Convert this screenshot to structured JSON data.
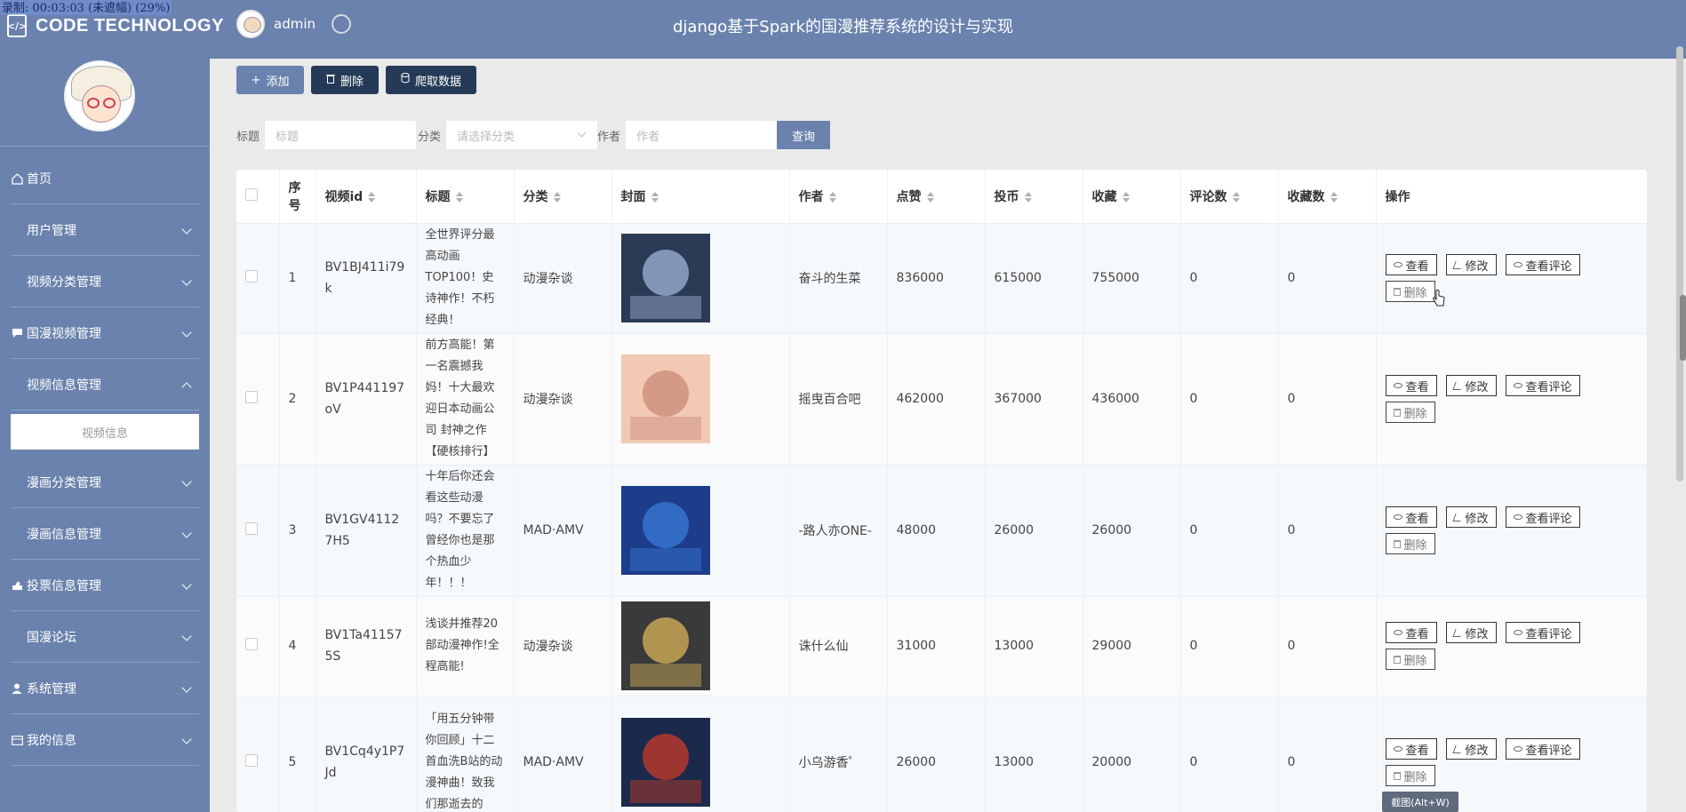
{
  "overlay": {
    "recording": "录制: 00:03:03 (未遮幅) (29%)"
  },
  "header": {
    "brand": "CODE TECHNOLOGY",
    "user": "admin",
    "title": "django基于Spark的国漫推荐系统的设计与实现"
  },
  "sidebar": {
    "items": [
      {
        "label": "首页",
        "icon": "home-icon"
      },
      {
        "label": "用户管理",
        "icon": "grid-icon"
      },
      {
        "label": "视频分类管理",
        "icon": "grid-icon"
      },
      {
        "label": "国漫视频管理",
        "icon": "comment-icon"
      },
      {
        "label": "视频信息管理",
        "icon": "grid-icon",
        "expanded": true
      },
      {
        "label": "漫画分类管理",
        "icon": "grid-icon"
      },
      {
        "label": "漫画信息管理",
        "icon": "grid-icon"
      },
      {
        "label": "投票信息管理",
        "icon": "vote-icon"
      },
      {
        "label": "国漫论坛",
        "icon": "grid-icon"
      },
      {
        "label": "系统管理",
        "icon": "user-icon"
      },
      {
        "label": "我的信息",
        "icon": "card-icon"
      }
    ],
    "subitem": "视频信息"
  },
  "toolbar": {
    "add": "添加",
    "delete": "删除",
    "crawl": "爬取数据"
  },
  "search": {
    "title_label": "标题",
    "title_placeholder": "标题",
    "category_label": "分类",
    "category_placeholder": "请选择分类",
    "author_label": "作者",
    "author_placeholder": "作者",
    "query": "查询"
  },
  "table": {
    "headers": [
      "序号",
      "视频id",
      "标题",
      "分类",
      "封面",
      "作者",
      "点赞",
      "投币",
      "收藏",
      "评论数",
      "收藏数",
      "操作"
    ],
    "actions": {
      "view": "查看",
      "edit": "修改",
      "view_comments": "查看评论",
      "delete": "删除"
    },
    "rows": [
      {
        "no": "1",
        "vid": "BV1BJ411i79k",
        "title": "全世界评分最高动画TOP100！史诗神作！不朽经典！",
        "category": "动漫杂谈",
        "author": "奋斗的生菜",
        "likes": "836000",
        "coins": "615000",
        "favorites": "755000",
        "comments": "0",
        "collects": "0"
      },
      {
        "no": "2",
        "vid": "BV1P441197oV",
        "title": "前方高能！第一名震撼我妈！十大最欢迎日本动画公司 封神之作【硬核排行】",
        "category": "动漫杂谈",
        "author": "摇曳百合吧",
        "likes": "462000",
        "coins": "367000",
        "favorites": "436000",
        "comments": "0",
        "collects": "0"
      },
      {
        "no": "3",
        "vid": "BV1GV41127H5",
        "title": "十年后你还会看这些动漫吗？不要忘了曾经你也是那个热血少年！！！",
        "category": "MAD·AMV",
        "author": "-路人亦ONE-",
        "likes": "48000",
        "coins": "26000",
        "favorites": "26000",
        "comments": "0",
        "collects": "0"
      },
      {
        "no": "4",
        "vid": "BV1Ta411575S",
        "title": "浅谈并推荐20部动漫神作!全程高能!",
        "category": "动漫杂谈",
        "author": "诛什么仙",
        "likes": "31000",
        "coins": "13000",
        "favorites": "29000",
        "comments": "0",
        "collects": "0"
      },
      {
        "no": "5",
        "vid": "BV1Cq4y1P7Jd",
        "title": "「用五分钟带你回顾」十二首血洗B站的动漫神曲！致我们那逝去的",
        "category": "MAD·AMV",
        "author": "小乌游香゜",
        "likes": "26000",
        "coins": "13000",
        "favorites": "20000",
        "comments": "0",
        "collects": "0"
      }
    ]
  },
  "tooltip": "截图(Alt+W)",
  "colors": {
    "primary": "#6a82ad",
    "dark_button": "#253a56"
  }
}
